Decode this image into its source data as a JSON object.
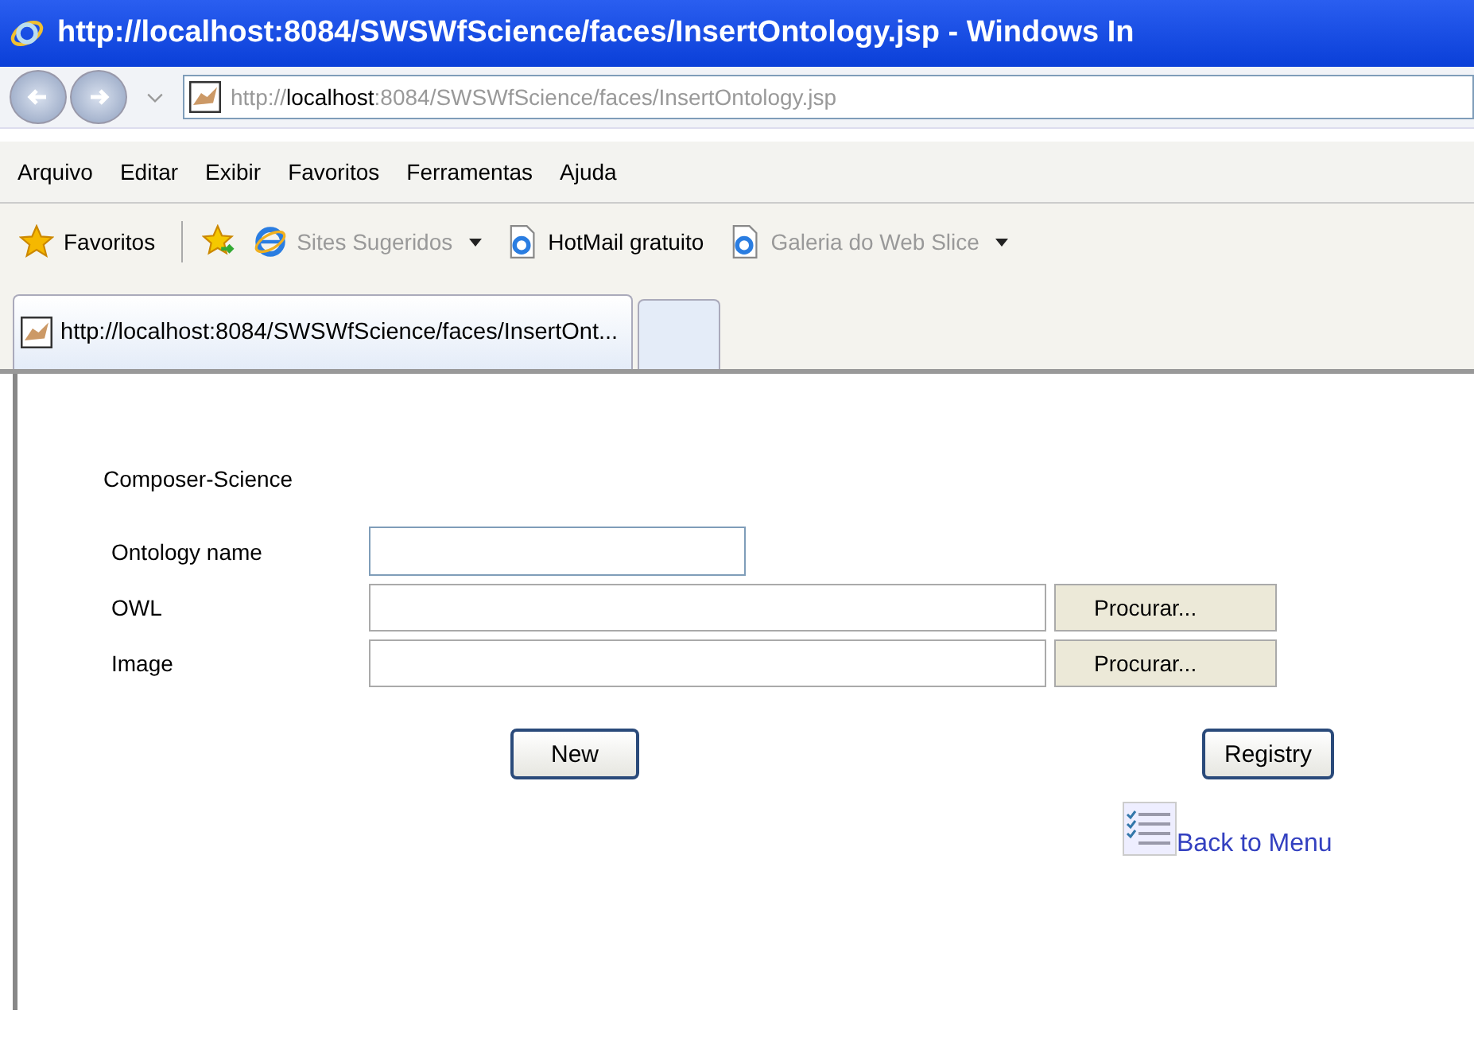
{
  "window": {
    "title": "http://localhost:8084/SWSWfScience/faces/InsertOntology.jsp - Windows In"
  },
  "address_bar": {
    "prefix": "http://",
    "host": "localhost",
    "rest": ":8084/SWSWfScience/faces/InsertOntology.jsp"
  },
  "menu_bar": [
    "Arquivo",
    "Editar",
    "Exibir",
    "Favoritos",
    "Ferramentas",
    "Ajuda"
  ],
  "favorites_bar": {
    "favorites": "Favoritos",
    "items": [
      {
        "label": "Sites Sugeridos",
        "dropdown": true,
        "disabled": true
      },
      {
        "label": "HotMail gratuito",
        "dropdown": false,
        "disabled": false
      },
      {
        "label": "Galeria do Web Slice",
        "dropdown": true,
        "disabled": true
      }
    ]
  },
  "tabs": [
    {
      "label": "http://localhost:8084/SWSWfScience/faces/InsertOnt...",
      "selected": true
    }
  ],
  "page": {
    "heading": "Composer-Science",
    "fields": [
      {
        "kind": "text",
        "label": "Ontology name"
      },
      {
        "kind": "file",
        "label": "OWL",
        "button": "Procurar..."
      },
      {
        "kind": "file",
        "label": "Image",
        "button": "Procurar..."
      }
    ],
    "buttons": [
      "New",
      "Registry"
    ],
    "back_link": "Back to Menu"
  }
}
